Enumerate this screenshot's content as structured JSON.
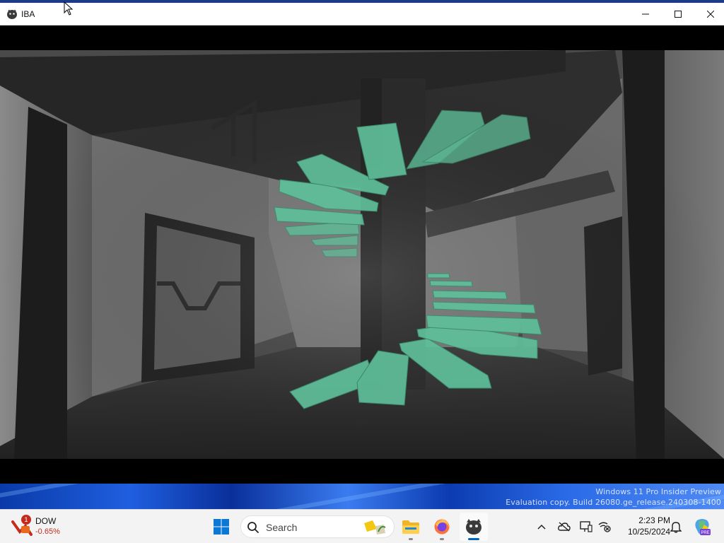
{
  "window": {
    "title": "IBA",
    "minimize_label": "Minimize",
    "maximize_label": "Maximize",
    "close_label": "Close"
  },
  "desktop": {
    "watermark_line1": "Windows 11 Pro Insider Preview",
    "watermark_line2": "Evaluation copy. Build 26080.ge_release.240308-1400"
  },
  "taskbar": {
    "widget": {
      "name": "DOW",
      "change": "-0.65%",
      "badge": "1"
    },
    "search": {
      "placeholder": "Search"
    },
    "apps": [
      {
        "name": "start",
        "icon": "windows-logo-icon"
      },
      {
        "name": "file-explorer",
        "icon": "folder-icon"
      },
      {
        "name": "firefox",
        "icon": "firefox-icon"
      },
      {
        "name": "iba",
        "icon": "iba-app-icon"
      }
    ],
    "tray": {
      "icons": [
        "chevron-up-icon",
        "onedrive-icon",
        "display-icon",
        "network-disconnected-icon"
      ],
      "time": "2:23 PM",
      "date": "10/25/2024",
      "notification_icon": "bell-icon",
      "copilot_icon": "copilot-icon"
    }
  },
  "colors": {
    "stair_accent": "#5fbf9a",
    "titlebar_bg": "#ffffff",
    "taskbar_bg": "#f3f3f3",
    "stock_down": "#c42b1c",
    "accent": "#0067c0"
  }
}
